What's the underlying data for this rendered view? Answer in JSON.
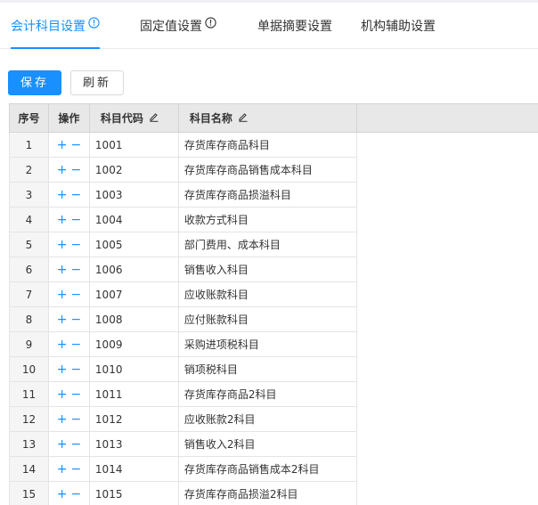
{
  "tabs": [
    {
      "label": "会计科目设置",
      "active": true,
      "has_info": true
    },
    {
      "label": "固定值设置",
      "active": false,
      "has_info": true
    },
    {
      "label": "单据摘要设置",
      "active": false,
      "has_info": false
    },
    {
      "label": "机构辅助设置",
      "active": false,
      "has_info": false
    }
  ],
  "toolbar": {
    "save_label": "保存",
    "refresh_label": "刷新"
  },
  "table": {
    "columns": {
      "seq": "序号",
      "op": "操作",
      "code": "科目代码",
      "name": "科目名称"
    },
    "op_add": "+",
    "op_del": "−",
    "rows": [
      {
        "seq": "1",
        "code": "1001",
        "name": "存货库存商品科目"
      },
      {
        "seq": "2",
        "code": "1002",
        "name": "存货库存商品销售成本科目"
      },
      {
        "seq": "3",
        "code": "1003",
        "name": "存货库存商品损溢科目"
      },
      {
        "seq": "4",
        "code": "1004",
        "name": "收款方式科目"
      },
      {
        "seq": "5",
        "code": "1005",
        "name": "部门费用、成本科目"
      },
      {
        "seq": "6",
        "code": "1006",
        "name": "销售收入科目"
      },
      {
        "seq": "7",
        "code": "1007",
        "name": "应收账款科目"
      },
      {
        "seq": "8",
        "code": "1008",
        "name": "应付账款科目"
      },
      {
        "seq": "9",
        "code": "1009",
        "name": "采购进项税科目"
      },
      {
        "seq": "10",
        "code": "1010",
        "name": "销项税科目"
      },
      {
        "seq": "11",
        "code": "1011",
        "name": "存货库存商品2科目"
      },
      {
        "seq": "12",
        "code": "1012",
        "name": "应收账款2科目"
      },
      {
        "seq": "13",
        "code": "1013",
        "name": "销售收入2科目"
      },
      {
        "seq": "14",
        "code": "1014",
        "name": "存货库存商品销售成本2科目"
      },
      {
        "seq": "15",
        "code": "1015",
        "name": "存货库存商品损溢2科目"
      }
    ]
  },
  "icons": {
    "tab_info": "info-circle-icon",
    "column_edit": "pencil-icon"
  },
  "colors": {
    "accent": "#1890ff",
    "header_bg": "#e8e8e8",
    "seq_bg": "#f5f5f5",
    "border": "#e4e4e4"
  }
}
